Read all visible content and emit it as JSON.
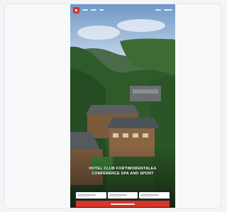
{
  "screenshot": {
    "hero_text": "HOTEL CLUB FORTIMORENTALEA CONFERENCE Spa and Sport",
    "colors": {
      "accent": "#d6362b",
      "sky": "#8fb3d8",
      "forest": "#2f5a2a",
      "roof": "#5a5f63"
    }
  }
}
